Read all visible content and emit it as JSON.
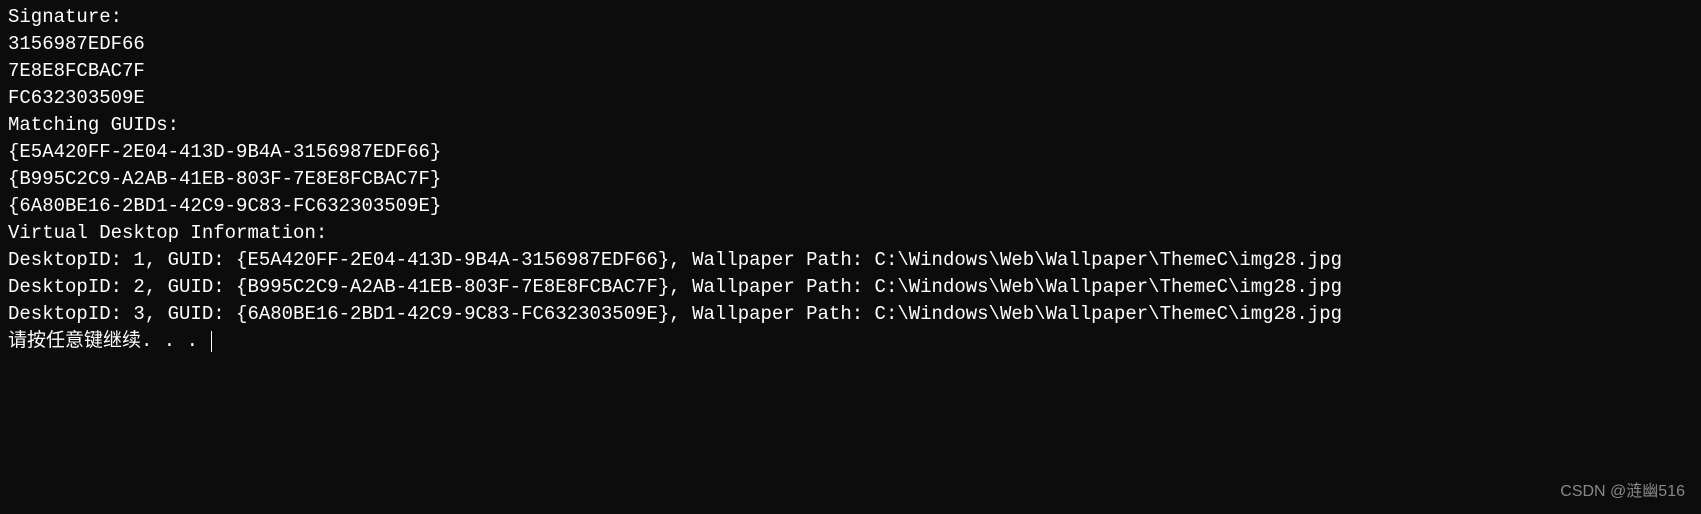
{
  "terminal": {
    "signature_label": "Signature:",
    "signatures": [
      "3156987EDF66",
      "7E8E8FCBAC7F",
      "FC632303509E"
    ],
    "matching_guids_label": "Matching GUIDs:",
    "matching_guids": [
      "{E5A420FF-2E04-413D-9B4A-3156987EDF66}",
      "{B995C2C9-A2AB-41EB-803F-7E8E8FCBAC7F}",
      "{6A80BE16-2BD1-42C9-9C83-FC632303509E}"
    ],
    "vdi_label": "Virtual Desktop Information:",
    "desktops": [
      {
        "line": "DesktopID: 1, GUID: {E5A420FF-2E04-413D-9B4A-3156987EDF66}, Wallpaper Path: C:\\Windows\\Web\\Wallpaper\\ThemeC\\img28.jpg"
      },
      {
        "line": "DesktopID: 2, GUID: {B995C2C9-A2AB-41EB-803F-7E8E8FCBAC7F}, Wallpaper Path: C:\\Windows\\Web\\Wallpaper\\ThemeC\\img28.jpg"
      },
      {
        "line": "DesktopID: 3, GUID: {6A80BE16-2BD1-42C9-9C83-FC632303509E}, Wallpaper Path: C:\\Windows\\Web\\Wallpaper\\ThemeC\\img28.jpg"
      }
    ],
    "prompt": "请按任意键继续. . . "
  },
  "watermark": "CSDN @涟幽516"
}
